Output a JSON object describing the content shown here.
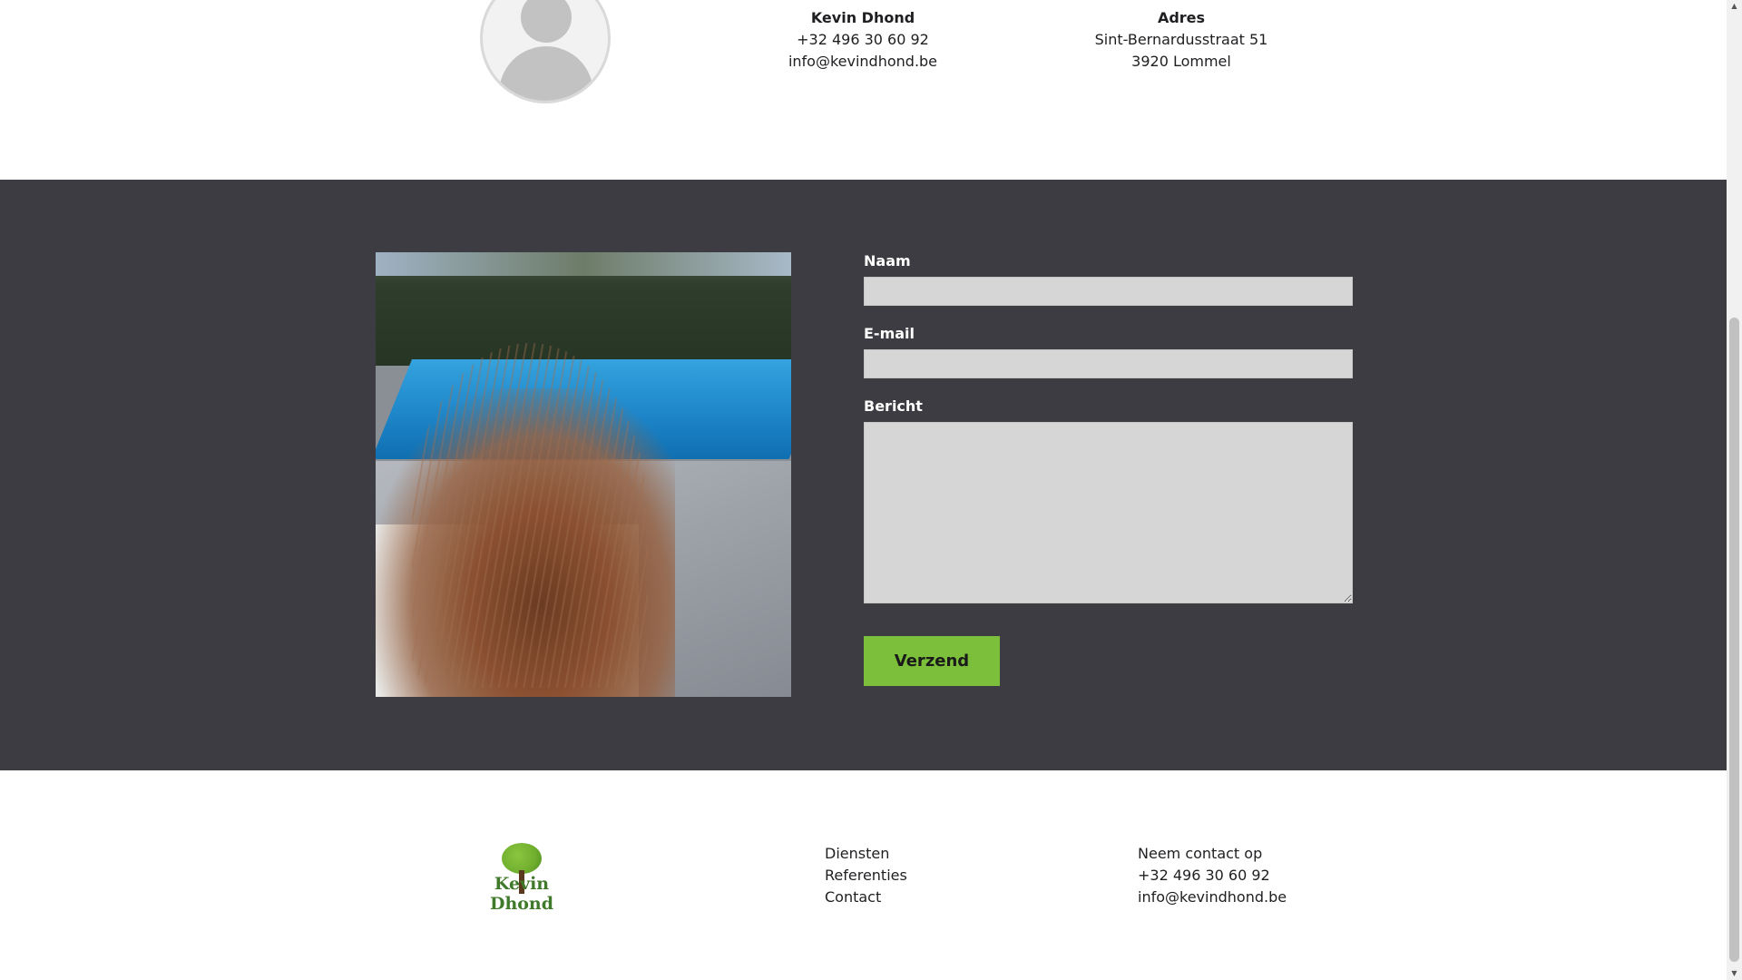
{
  "contact_info": {
    "person": {
      "title": "Kevin Dhond",
      "phone": "+32 496 30 60 92",
      "email": "info@kevindhond.be"
    },
    "address": {
      "title": "Adres",
      "street": "Sint-Bernardusstraat 51",
      "city": "3920 Lommel"
    }
  },
  "form": {
    "name_label": "Naam",
    "name_value": "",
    "email_label": "E-mail",
    "email_value": "",
    "message_label": "Bericht",
    "message_value": "",
    "submit_label": "Verzend"
  },
  "footer": {
    "logo_text": "Kevin Dhond",
    "links": [
      "Diensten",
      "Referenties",
      "Contact"
    ],
    "contact_heading": "Neem contact op",
    "contact_phone": "+32 496 30 60 92",
    "contact_email": "info@kevindhond.be"
  },
  "colors": {
    "dark_section": "#3d3c42",
    "button": "#7bbf3a",
    "input_bg": "#d6d6d6"
  }
}
